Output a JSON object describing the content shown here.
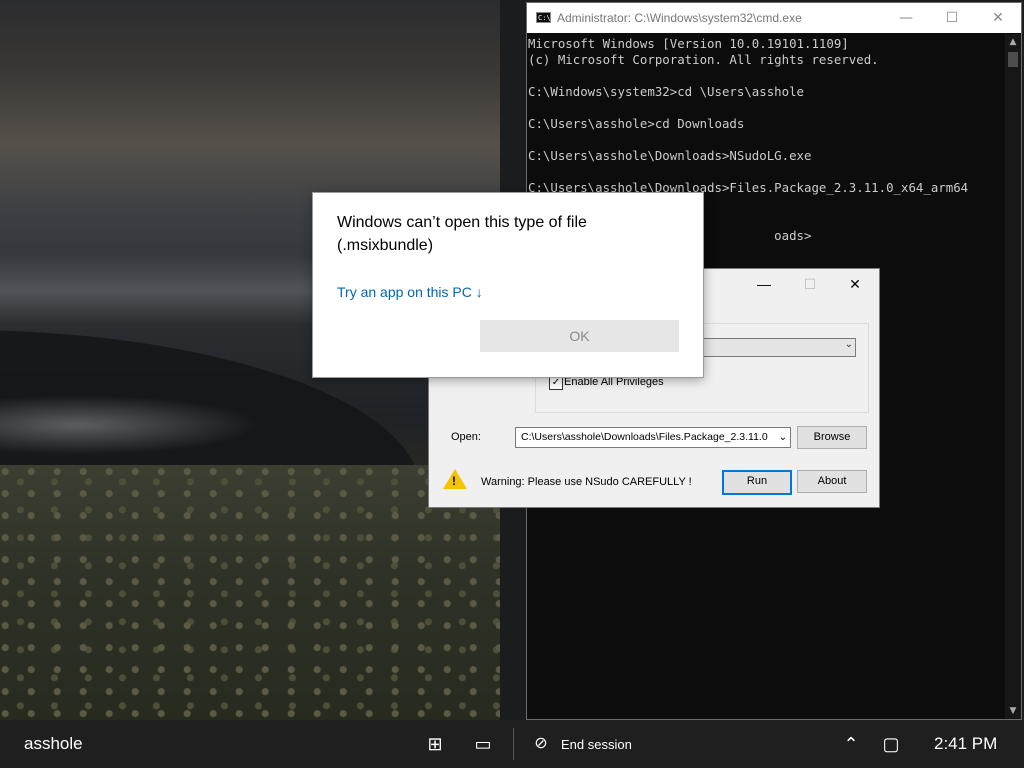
{
  "cmd": {
    "title": "Administrator: C:\\Windows\\system32\\cmd.exe",
    "icon_text": "C:\\",
    "controls": {
      "minimize": "—",
      "maximize": "☐",
      "close": "✕"
    },
    "lines": [
      "Microsoft Windows [Version 10.0.19101.1109]",
      "(c) Microsoft Corporation. All rights reserved.",
      "",
      "C:\\Windows\\system32>cd \\Users\\asshole",
      "",
      "C:\\Users\\asshole>cd Downloads",
      "",
      "C:\\Users\\asshole\\Downloads>NSudoLG.exe",
      "",
      "C:\\Users\\asshole\\Downloads>Files.Package_2.3.11.0_x64_arm64",
      "",
      "",
      "                                 oads>"
    ]
  },
  "nsudo": {
    "controls": {
      "minimize": "—",
      "maximize": "☐",
      "close": "✕"
    },
    "enable_all_privileges_label": "Enable All Privileges",
    "enable_all_privileges_checked": true,
    "check_mark": "✓",
    "open_label": "Open:",
    "path_value": "C:\\Users\\asshole\\Downloads\\Files.Package_2.3.11.0",
    "dropdown_arrow": "⌄",
    "browse_label": "Browse",
    "warning_text": "Warning: Please use NSudo CAREFULLY !",
    "run_label": "Run",
    "about_label": "About"
  },
  "dialog": {
    "heading": "Windows can’t open this type of file (.msixbundle)",
    "link_text": "Try an app on this PC ↓",
    "ok_label": "OK"
  },
  "taskbar": {
    "user": "asshole",
    "start_icon": "⊞",
    "task_view_icon": "▭",
    "end_session_icon": "⊘",
    "end_session_label": "End session",
    "tray_up_icon": "⌃",
    "notification_icon": "▢",
    "clock": "2:41 PM"
  }
}
